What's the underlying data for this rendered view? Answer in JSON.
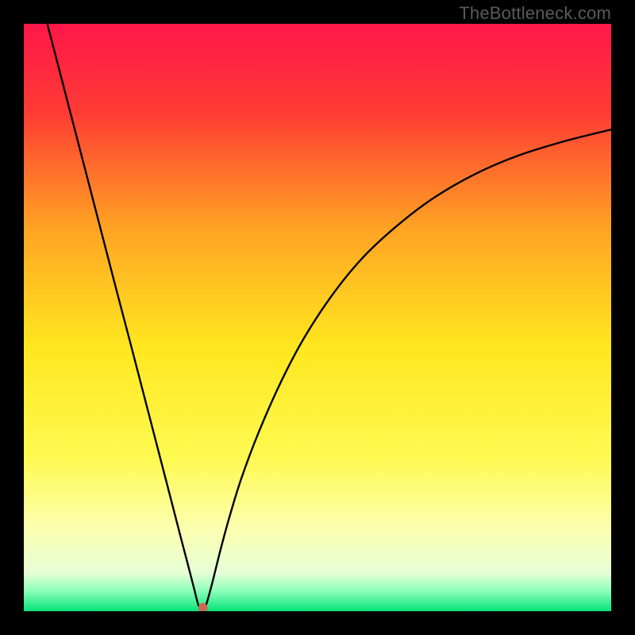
{
  "watermark": "TheBottleneck.com",
  "chart_data": {
    "type": "line",
    "title": "",
    "xlabel": "",
    "ylabel": "",
    "xlim": [
      0,
      100
    ],
    "ylim": [
      0,
      100
    ],
    "background_gradient_stops": [
      {
        "offset": 0.0,
        "color": "#ff174a"
      },
      {
        "offset": 0.15,
        "color": "#ff3b34"
      },
      {
        "offset": 0.35,
        "color": "#ffa423"
      },
      {
        "offset": 0.55,
        "color": "#ffe71f"
      },
      {
        "offset": 0.74,
        "color": "#fffa52"
      },
      {
        "offset": 0.86,
        "color": "#fbffb0"
      },
      {
        "offset": 0.935,
        "color": "#e7ffd7"
      },
      {
        "offset": 0.965,
        "color": "#8dffba"
      },
      {
        "offset": 1.0,
        "color": "#05e47a"
      }
    ],
    "series": [
      {
        "name": "bottleneck-curve",
        "x": [
          4,
          6,
          8,
          10,
          12,
          14,
          16,
          18,
          20,
          22,
          24,
          25.5,
          27,
          28,
          29,
          29.7,
          30.3,
          31,
          32,
          33.5,
          35,
          37,
          40,
          44,
          48,
          53,
          58,
          64,
          70,
          77,
          84,
          92,
          100
        ],
        "y": [
          100,
          92.3,
          84.6,
          76.9,
          69.2,
          61.5,
          53.8,
          46.2,
          38.5,
          30.8,
          23.1,
          17.3,
          11.5,
          7.7,
          3.8,
          1.1,
          0.2,
          1.0,
          4.5,
          10.5,
          16.0,
          22.5,
          30.5,
          39.5,
          47.0,
          54.5,
          60.5,
          66.0,
          70.5,
          74.5,
          77.5,
          80.0,
          82.0
        ]
      }
    ],
    "marker": {
      "x": 30.5,
      "y": 0.6,
      "color": "#c96a55",
      "radius_px": 6
    }
  }
}
